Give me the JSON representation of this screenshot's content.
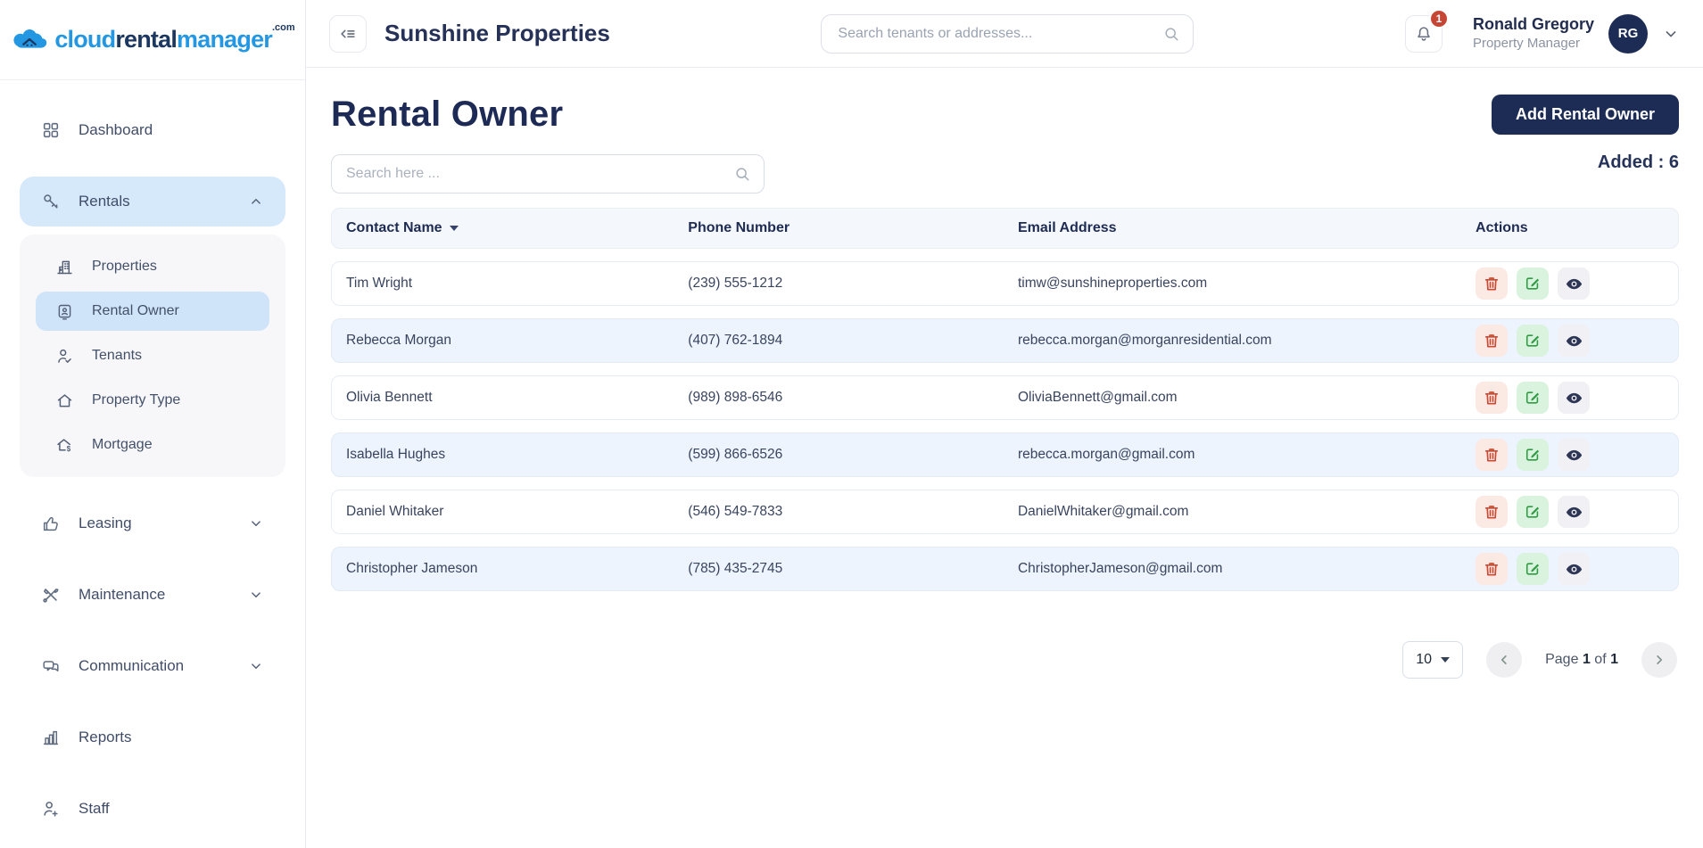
{
  "logo": {
    "cloud": "cloud",
    "rental": "rental",
    "manager": "manager",
    "tld": ".com"
  },
  "sidebar": {
    "dashboard": "Dashboard",
    "rentals": "Rentals",
    "properties": "Properties",
    "rental_owner": "Rental Owner",
    "tenants": "Tenants",
    "property_type": "Property Type",
    "mortgage": "Mortgage",
    "leasing": "Leasing",
    "maintenance": "Maintenance",
    "communication": "Communication",
    "reports": "Reports",
    "staff": "Staff"
  },
  "topbar": {
    "workspace": "Sunshine Properties",
    "search_placeholder": "Search tenants or addresses...",
    "notification_count": "1",
    "user": {
      "name": "Ronald Gregory",
      "role": "Property Manager",
      "initials": "RG"
    }
  },
  "page": {
    "title": "Rental Owner",
    "search_placeholder": "Search here ...",
    "add_button": "Add Rental Owner",
    "added": "Added : 6"
  },
  "table": {
    "headers": {
      "name": "Contact Name",
      "phone": "Phone Number",
      "email": "Email Address",
      "actions": "Actions"
    },
    "rows": [
      {
        "name": "Tim Wright",
        "phone": "(239) 555-1212",
        "email": "timw@sunshineproperties.com"
      },
      {
        "name": "Rebecca Morgan",
        "phone": "(407) 762-1894",
        "email": "rebecca.morgan@morganresidential.com"
      },
      {
        "name": "Olivia Bennett",
        "phone": "(989) 898-6546",
        "email": "OliviaBennett@gmail.com"
      },
      {
        "name": "Isabella Hughes",
        "phone": "(599) 866-6526",
        "email": "rebecca.morgan@gmail.com"
      },
      {
        "name": "Daniel Whitaker",
        "phone": "(546) 549-7833",
        "email": "DanielWhitaker@gmail.com"
      },
      {
        "name": "Christopher Jameson",
        "phone": "(785) 435-2745",
        "email": "ChristopherJameson@gmail.com"
      }
    ]
  },
  "pagination": {
    "page_size": "10",
    "page_label": "Page",
    "current": "1",
    "of_label": "of",
    "total": "1"
  },
  "colors": {
    "accent_navy": "#1c2c55",
    "active_blue": "#d6e9fb",
    "submenu_bg": "#f7f7f9",
    "row_alt": "#edf4fd",
    "header_row_bg": "#f4f7fb",
    "delete_red": "#cb4a33",
    "edit_green": "#2f9c44",
    "badge_red": "#c64635",
    "logo_blue": "#2497e3"
  }
}
